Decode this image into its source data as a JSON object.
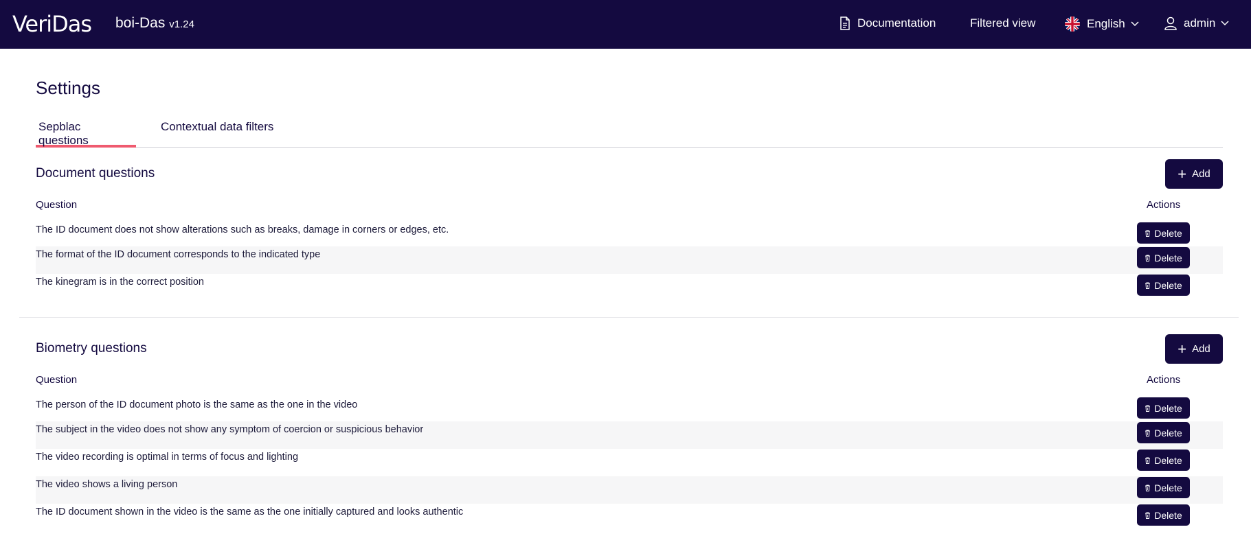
{
  "header": {
    "logo_text": "VeriDas",
    "app_name": "boi-Das",
    "app_version": "v1.24",
    "nav": {
      "documentation": "Documentation",
      "filtered_view": "Filtered view",
      "language": "English",
      "user": "admin"
    }
  },
  "page": {
    "title": "Settings",
    "tabs": [
      {
        "label": "Sepblac questions",
        "active": true
      },
      {
        "label": "Contextual data filters",
        "active": false
      }
    ]
  },
  "document_section": {
    "title": "Document questions",
    "add_label": "Add",
    "col_question": "Question",
    "col_actions": "Actions",
    "rows": [
      {
        "question": "The ID document does not show alterations such as breaks, damage in corners or edges, etc.",
        "action": "Delete"
      },
      {
        "question": "The format of the ID document corresponds to the indicated type",
        "action": "Delete"
      },
      {
        "question": "The kinegram is in the correct position",
        "action": "Delete"
      }
    ]
  },
  "biometry_section": {
    "title": "Biometry questions",
    "add_label": "Add",
    "col_question": "Question",
    "col_actions": "Actions",
    "rows": [
      {
        "question": "The person of the ID document photo is the same as the one in the video",
        "action": "Delete"
      },
      {
        "question": "The subject in the video does not show any symptom of coercion or suspicious behavior",
        "action": "Delete"
      },
      {
        "question": "The video recording is optimal in terms of focus and lighting",
        "action": "Delete"
      },
      {
        "question": "The video shows a living person",
        "action": "Delete"
      },
      {
        "question": "The ID document shown in the video is the same as the one initially captured and looks authentic",
        "action": "Delete"
      }
    ]
  },
  "colors": {
    "header_bg": "#140a40",
    "primary_button": "#140a40",
    "tab_active_underline": "#ef5a6f",
    "row_stripe": "#f6f6f7"
  },
  "icons": {
    "documentation": "document-icon",
    "language": "uk-flag-icon",
    "user": "user-icon",
    "add": "plus-icon",
    "delete": "trash-icon"
  }
}
